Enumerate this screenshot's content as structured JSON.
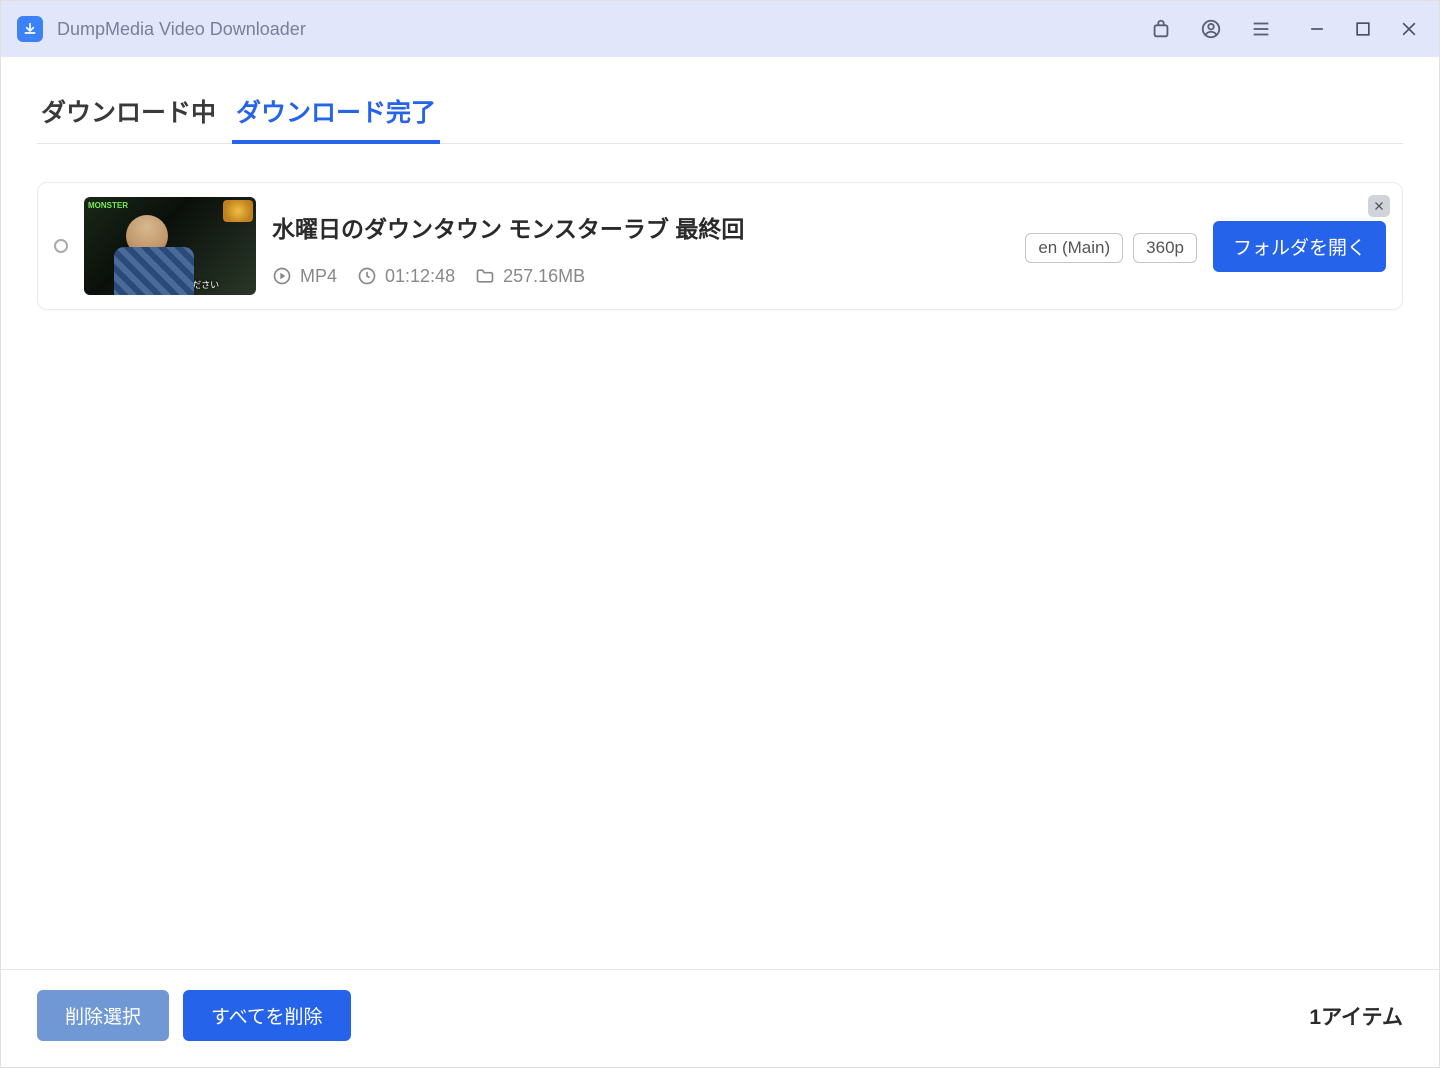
{
  "app": {
    "title": "DumpMedia Video Downloader"
  },
  "tabs": {
    "downloading": "ダウンロード中",
    "completed": "ダウンロード完了"
  },
  "items": [
    {
      "title": "水曜日のダウンタウン モンスターラブ 最終回",
      "format": "MP4",
      "duration": "01:12:48",
      "size": "257.16MB",
      "lang_tag": "en (Main)",
      "quality_tag": "360p",
      "open_folder": "フォルダを開く",
      "thumb_subtitle": "僕と付き合ってください"
    }
  ],
  "footer": {
    "delete_selected": "削除選択",
    "delete_all": "すべてを削除",
    "count_label": "1アイテム"
  }
}
